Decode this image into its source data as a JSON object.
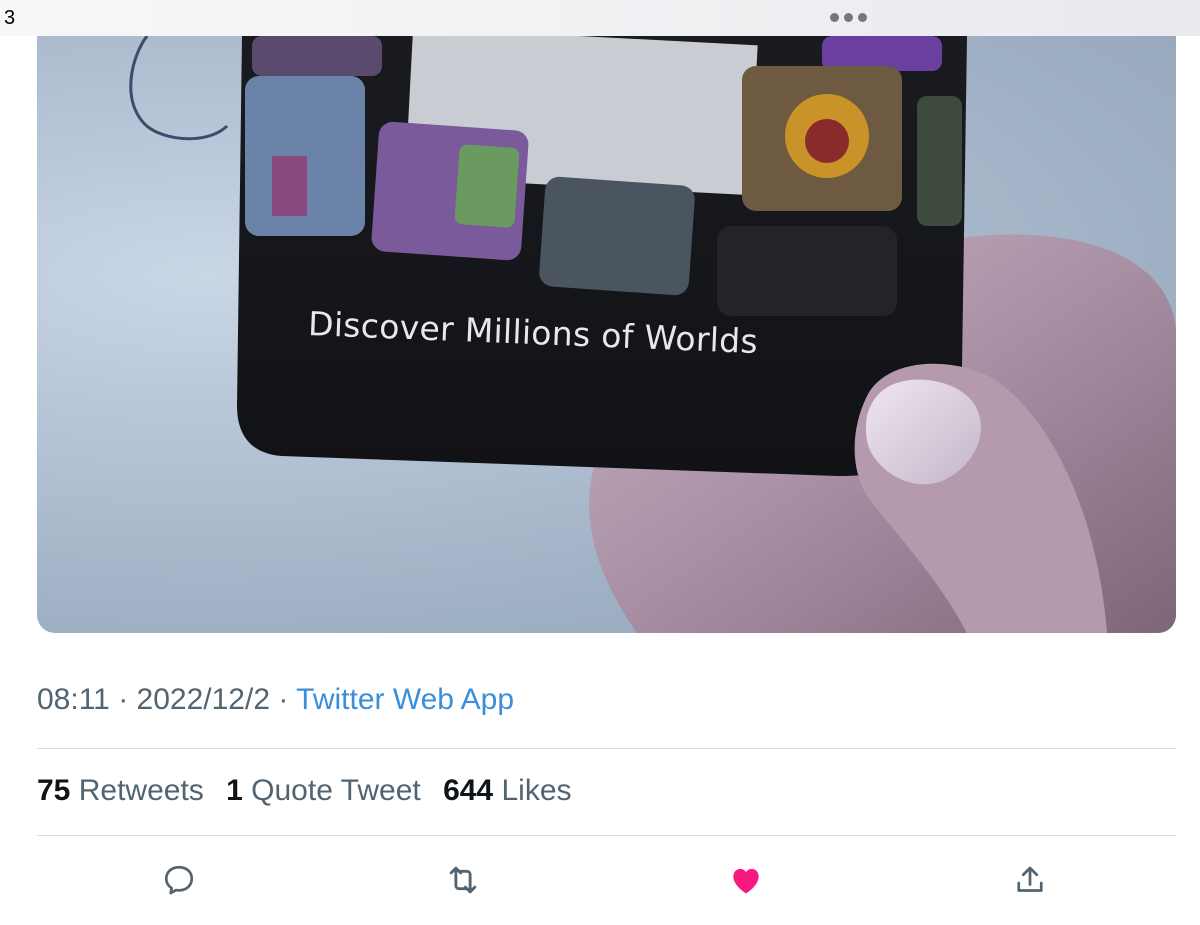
{
  "status_bar": {
    "time": "3"
  },
  "media": {
    "caption": "Discover Millions of Worlds"
  },
  "tweet": {
    "time": "08:11",
    "separator1": "·",
    "date": "2022/12/2",
    "separator2": "·",
    "source": "Twitter Web App"
  },
  "stats": {
    "retweets_count": "75",
    "retweets_label": "Retweets",
    "quotes_count": "1",
    "quotes_label": "Quote Tweet",
    "likes_count": "644",
    "likes_label": "Likes"
  },
  "actions": {
    "reply_icon": "comment-bubble-icon",
    "retweet_icon": "retweet-arrows-icon",
    "like_icon": "heart-filled-icon",
    "share_icon": "share-upload-icon",
    "like_color": "#f91880",
    "icon_color": "#536471"
  },
  "colors": {
    "link": "#3b8fd9",
    "secondary_text": "#536471",
    "primary_text": "#0f1419"
  }
}
